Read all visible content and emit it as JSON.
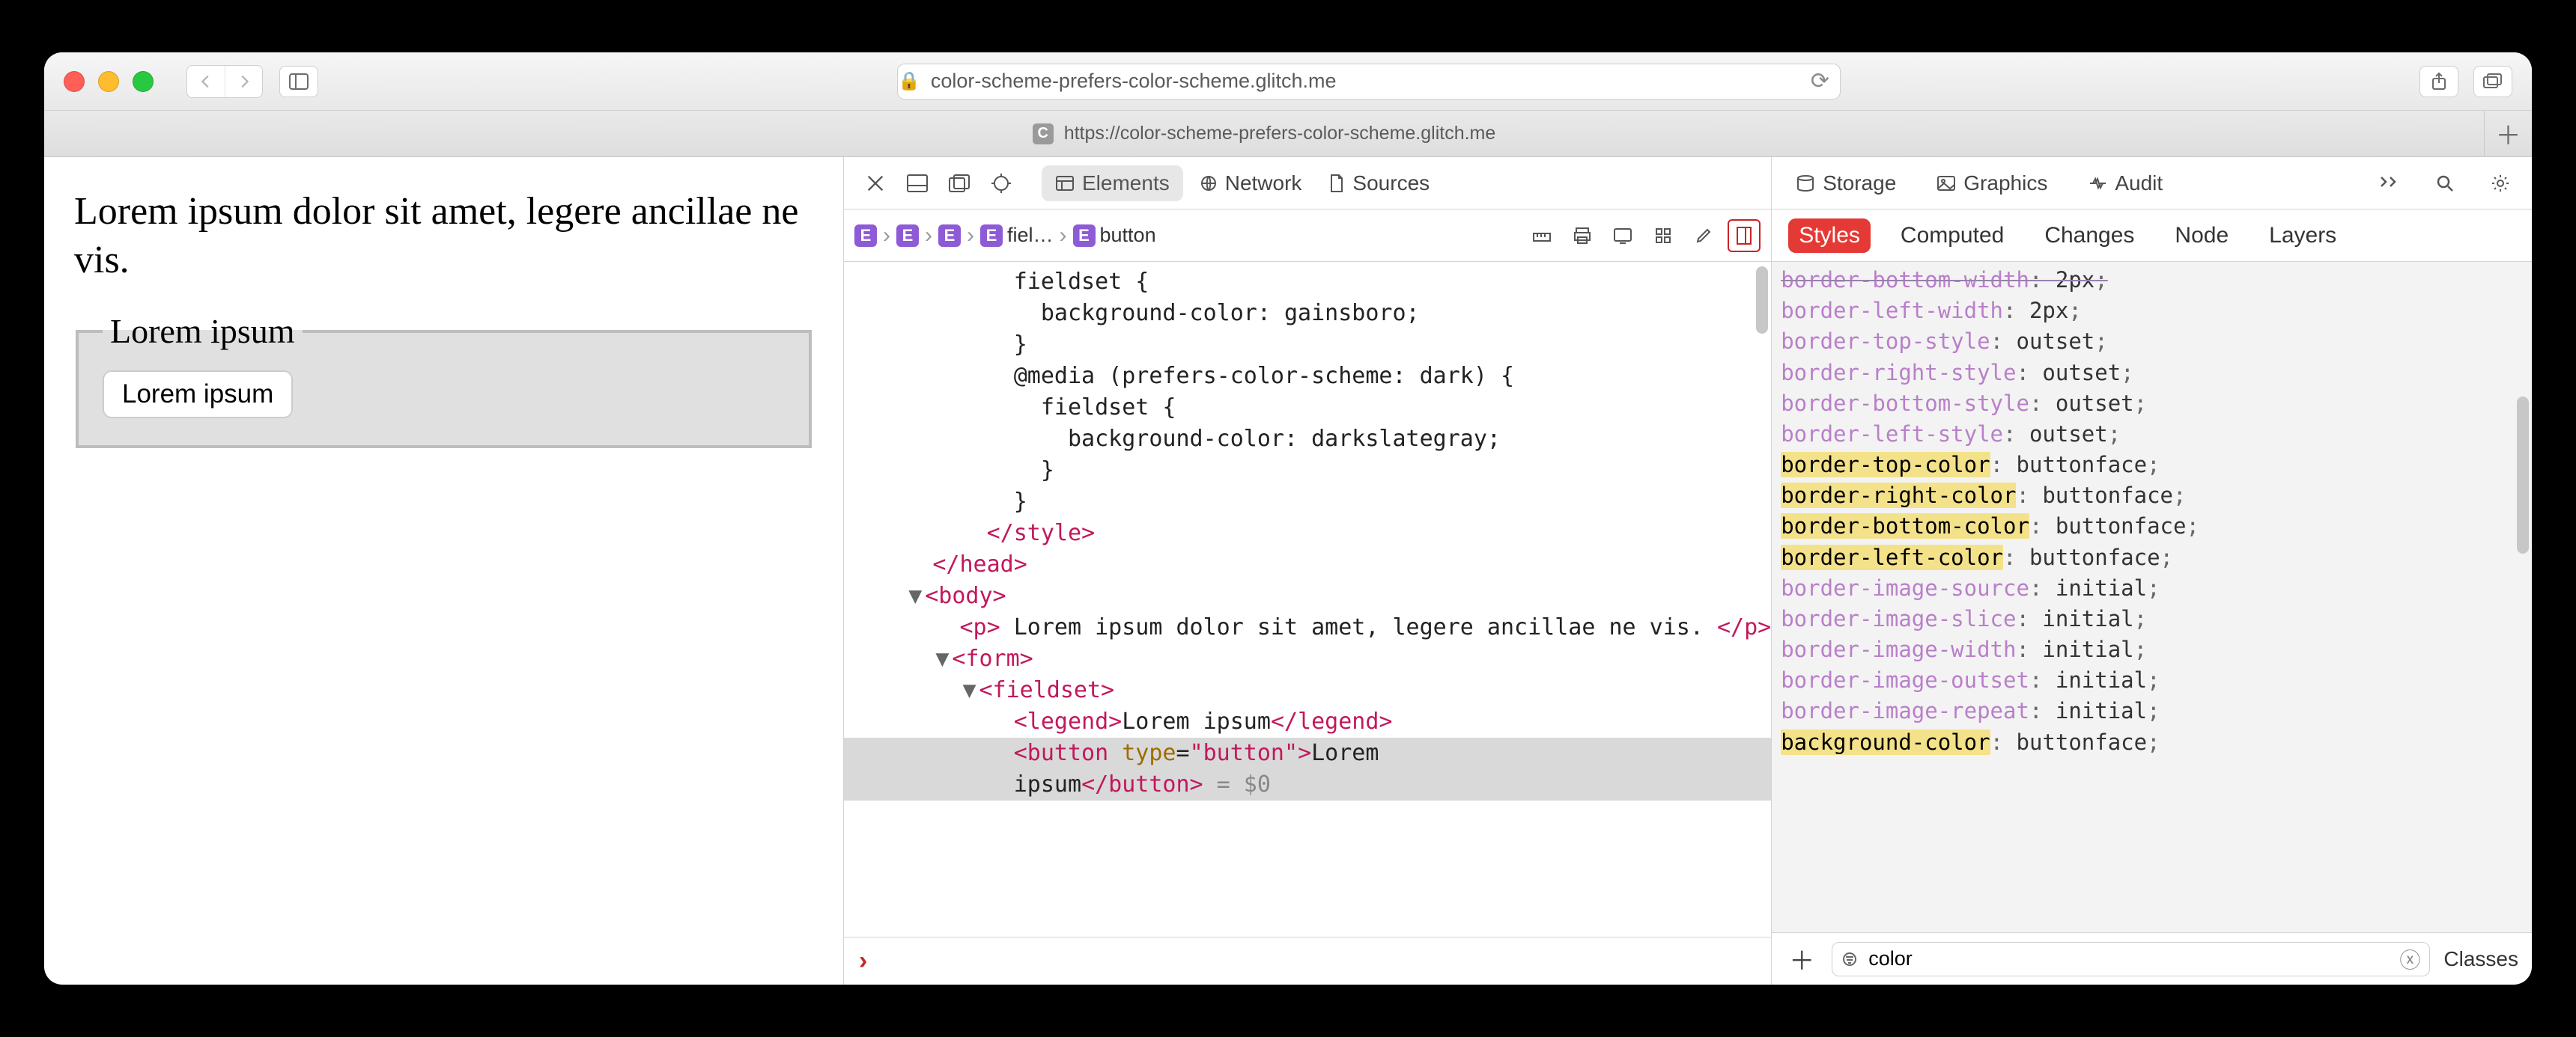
{
  "browser": {
    "url_display": "color-scheme-prefers-color-scheme.glitch.me",
    "tab_url": "https://color-scheme-prefers-color-scheme.glitch.me",
    "tab_favicon_letter": "C"
  },
  "page": {
    "paragraph": "Lorem ipsum dolor sit amet, legere ancillae ne vis.",
    "legend": "Lorem ipsum",
    "button_label": "Lorem ipsum"
  },
  "devtools": {
    "tabs": {
      "elements": "Elements",
      "network": "Network",
      "sources": "Sources",
      "storage": "Storage",
      "graphics": "Graphics",
      "audit": "Audit"
    },
    "breadcrumb": {
      "items": [
        {
          "badge": "E",
          "label": ""
        },
        {
          "badge": "E",
          "label": ""
        },
        {
          "badge": "E",
          "label": ""
        },
        {
          "badge": "E",
          "label": "fiel…"
        },
        {
          "badge": "E",
          "label": "button"
        }
      ]
    },
    "code": {
      "l1": "            fieldset {",
      "l2": "              background-color: gainsboro;",
      "l3": "            }",
      "l4": "            @media (prefers-color-scheme: dark) {",
      "l5": "              fieldset {",
      "l6": "                background-color: darkslategray;",
      "l7": "              }",
      "l8": "            }",
      "style_close": "</style>",
      "head_close": "</head>",
      "body_open": "<body>",
      "p_open": "<p>",
      "p_text": " Lorem ipsum dolor sit amet, legere ancillae ne vis. ",
      "p_close": "</p>",
      "form_open": "<form>",
      "fieldset_open": "<fieldset>",
      "legend_open": "<legend>",
      "legend_text": "Lorem ipsum",
      "legend_close": "</legend>",
      "button_open_a": "<button",
      "button_attr_name": " type",
      "button_attr_eq": "=",
      "button_attr_val": "\"button\"",
      "button_open_b": ">",
      "button_text_a": "Lorem",
      "button_text_b": "ipsum",
      "button_close": "</button>",
      "dollar": " = $0"
    },
    "styles_tabs": {
      "styles": "Styles",
      "computed": "Computed",
      "changes": "Changes",
      "node": "Node",
      "layers": "Layers"
    },
    "properties": [
      {
        "name": "border-bottom-width",
        "value": "2px",
        "hl": false,
        "struck": true
      },
      {
        "name": "border-left-width",
        "value": "2px",
        "hl": false,
        "struck": false
      },
      {
        "name": "border-top-style",
        "value": "outset",
        "hl": false,
        "struck": false
      },
      {
        "name": "border-right-style",
        "value": "outset",
        "hl": false,
        "struck": false
      },
      {
        "name": "border-bottom-style",
        "value": "outset",
        "hl": false,
        "struck": false
      },
      {
        "name": "border-left-style",
        "value": "outset",
        "hl": false,
        "struck": false
      },
      {
        "name": "border-top-color",
        "value": "buttonface",
        "hl": true,
        "struck": false
      },
      {
        "name": "border-right-color",
        "value": "buttonface",
        "hl": true,
        "struck": false
      },
      {
        "name": "border-bottom-color",
        "value": "buttonface",
        "hl": true,
        "struck": false
      },
      {
        "name": "border-left-color",
        "value": "buttonface",
        "hl": true,
        "struck": false
      },
      {
        "name": "border-image-source",
        "value": "initial",
        "hl": false,
        "struck": false
      },
      {
        "name": "border-image-slice",
        "value": "initial",
        "hl": false,
        "struck": false
      },
      {
        "name": "border-image-width",
        "value": "initial",
        "hl": false,
        "struck": false
      },
      {
        "name": "border-image-outset",
        "value": "initial",
        "hl": false,
        "struck": false
      },
      {
        "name": "border-image-repeat",
        "value": "initial",
        "hl": false,
        "struck": false
      },
      {
        "name": "background-color",
        "value": "buttonface",
        "hl": true,
        "struck": false
      }
    ],
    "filter": {
      "value": "color",
      "classes_label": "Classes"
    }
  }
}
